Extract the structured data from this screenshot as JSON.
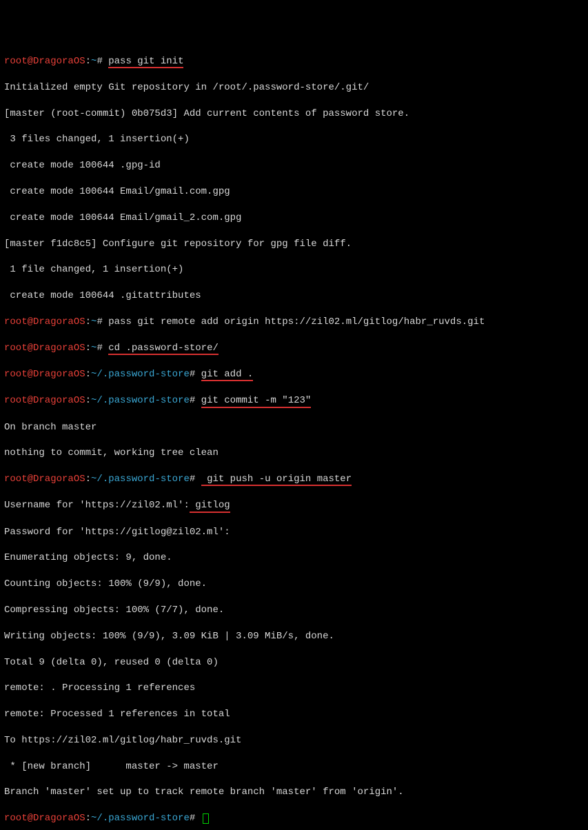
{
  "prompt1_user": "root@DragoraOS",
  "prompt1_path": "~",
  "prompt1_hash": "# ",
  "cmd1": "pass git init",
  "out1": "Initialized empty Git repository in /root/.password-store/.git/",
  "out2": "[master (root-commit) 0b075d3] Add current contents of password store.",
  "out3": " 3 files changed, 1 insertion(+)",
  "out4": " create mode 100644 .gpg-id",
  "out5": " create mode 100644 Email/gmail.com.gpg",
  "out6": " create mode 100644 Email/gmail_2.com.gpg",
  "out7": "[master f1dc8c5] Configure git repository for gpg file diff.",
  "out8": " 1 file changed, 1 insertion(+)",
  "out9": " create mode 100644 .gitattributes",
  "cmd2": "pass git remote add origin https://zil02.ml/gitlog/habr_ruvds.git",
  "cmd3": "cd .password-store/",
  "prompt2_path": "~/.password-store",
  "cmd4": "git add .",
  "cmd5": "git commit -m \"123\"",
  "out10": "On branch master",
  "out11": "nothing to commit, working tree clean",
  "cmd6_space": " ",
  "cmd6": "git push -u origin master",
  "out12_a": "Username for 'https://zil02.ml':",
  "out12_b": " gitlog",
  "out13": "Password for 'https://gitlog@zil02.ml':",
  "out14": "Enumerating objects: 9, done.",
  "out15": "Counting objects: 100% (9/9), done.",
  "out16": "Compressing objects: 100% (7/7), done.",
  "out17": "Writing objects: 100% (9/9), 3.09 KiB | 3.09 MiB/s, done.",
  "out18": "Total 9 (delta 0), reused 0 (delta 0)",
  "out19": "remote: . Processing 1 references",
  "out20": "remote: Processed 1 references in total",
  "out21": "To https://zil02.ml/gitlog/habr_ruvds.git",
  "out22": " * [new branch]      master -> master",
  "out23": "Branch 'master' set up to track remote branch 'master' from 'origin'.",
  "colon": ":"
}
